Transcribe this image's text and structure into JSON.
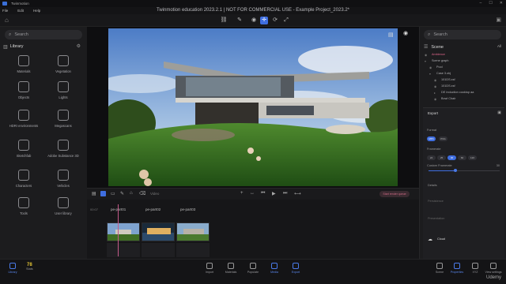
{
  "app": {
    "name": "Twinmotion",
    "document_title": "Twinmotion education 2023.2.1 | NOT FOR COMMERCIAL USE - Example Project_2023.2*"
  },
  "menu": [
    "File",
    "Edit",
    "Help"
  ],
  "window_controls": [
    "–",
    "☐",
    "✕"
  ],
  "left": {
    "search_placeholder": "Search",
    "library_title": "Library",
    "items": [
      "Materials",
      "Vegetation",
      "Objects",
      "Lights",
      "HDRI environments",
      "Megascans",
      "Sketchfab",
      "Adobe Substance 3D",
      "Characters",
      "Vehicles",
      "Tools",
      "User library"
    ]
  },
  "timeline": {
    "video_label": "Video",
    "render_button": "Start render queue",
    "duration": "00:07",
    "shots": [
      "pe-part01",
      "pe-part02",
      "pe-part03"
    ]
  },
  "right": {
    "search_placeholder": "Search",
    "scene_title": "Scene",
    "scene_filter": "All",
    "tree": [
      {
        "label": "Ambience",
        "accent": true
      },
      {
        "label": "Scene graph",
        "accent": false
      },
      {
        "label": "Pool",
        "accent": false
      },
      {
        "label": "Case 3.obj",
        "accent": false
      },
      {
        "label": "101DS.xsf",
        "accent": false
      },
      {
        "label": "101DS.xsf",
        "accent": false
      },
      {
        "label": "DE Induction cooktop aa",
        "accent": false
      },
      {
        "label": "Bowl Chair",
        "accent": false
      }
    ],
    "export": {
      "title": "Export",
      "format_label": "Format",
      "formats": [
        "MP4",
        "PNG"
      ],
      "framerate_label": "Framerate",
      "framerates": [
        "24",
        "25",
        "30",
        "60",
        "120"
      ],
      "framerate_selected": "30",
      "motion_blur_label": "Custom Framerate",
      "slider_value": 0.38,
      "slider_readout": "30",
      "sections": [
        "Details",
        "Persistence",
        "Presentation",
        "Cloud"
      ]
    }
  },
  "bottom": {
    "library_label": "Library",
    "stats_value": "78",
    "stats_label": "Stats",
    "tabs": [
      "Import",
      "Materials",
      "Populate",
      "Media",
      "Export"
    ],
    "active_tab": "Media",
    "right_tabs": [
      "Scene",
      "Properties",
      "XYZ",
      "View settings"
    ],
    "active_right": "Properties"
  },
  "colors": {
    "accent": "#3f6ee0",
    "highlight": "#e0678c",
    "stats": "#e4c534"
  },
  "watermark": "Udemy"
}
